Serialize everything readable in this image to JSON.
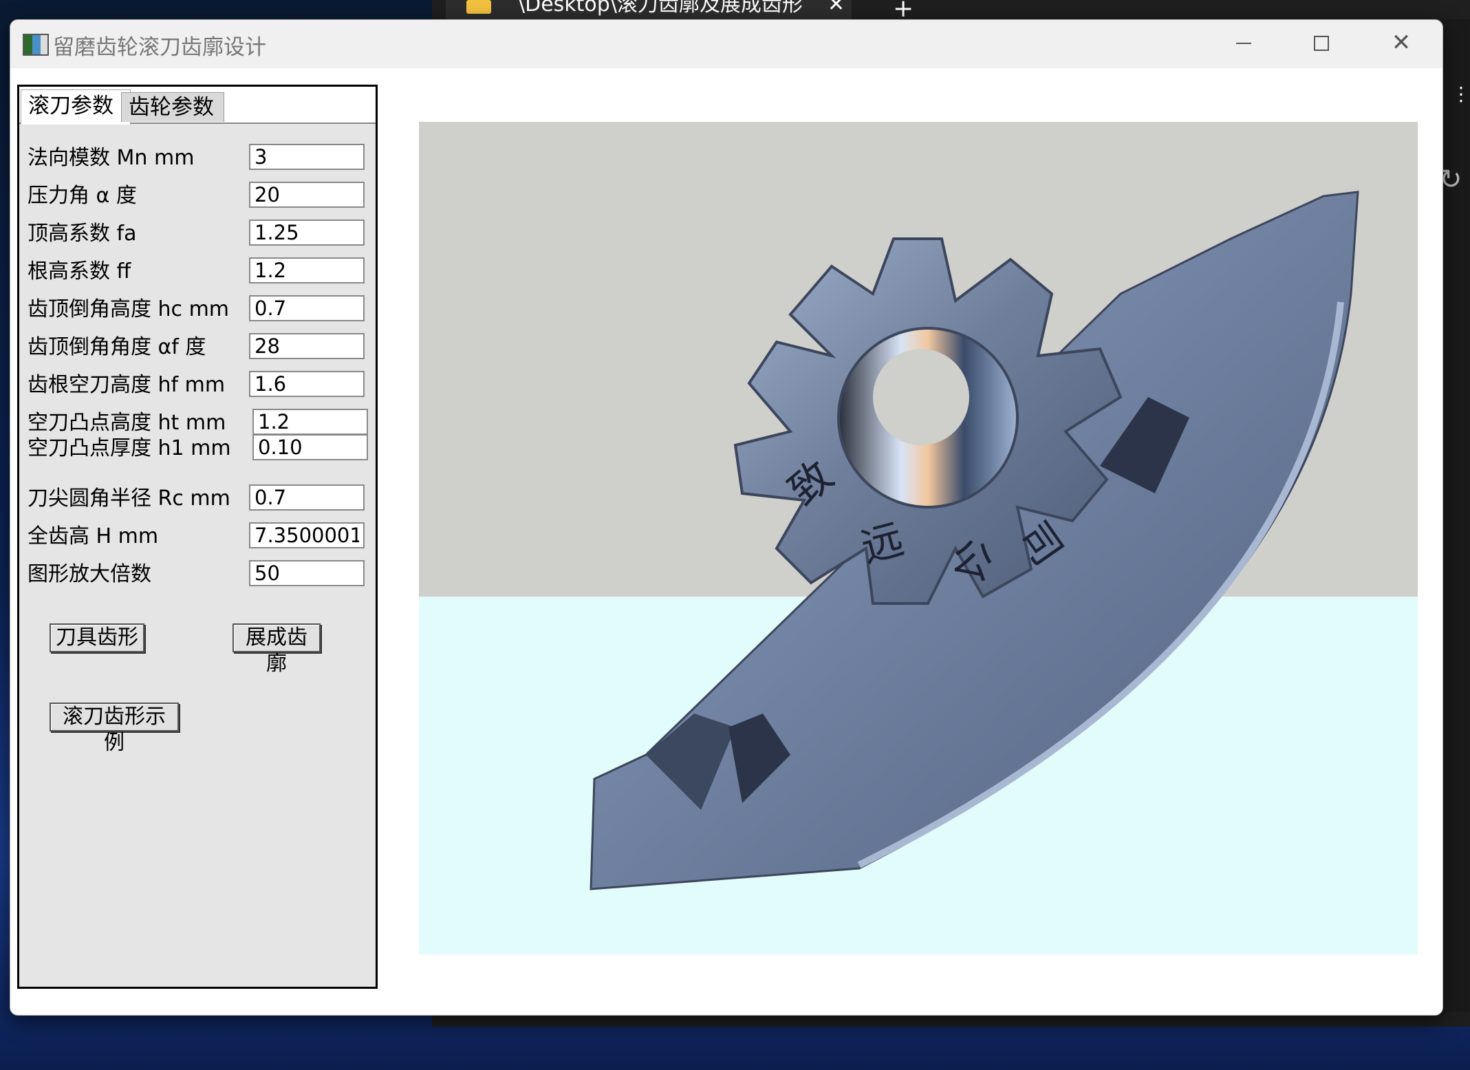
{
  "background_tab": {
    "title": "\\Desktop\\滚刀齿廓及展成齿形",
    "close_glyph": "✕",
    "new_tab_glyph": "+"
  },
  "window": {
    "title": "留磨齿轮滚刀齿廓设计",
    "controls": {
      "minimize": "minimize",
      "maximize": "maximize",
      "close": "✕"
    }
  },
  "tabs": [
    {
      "label": "滚刀参数",
      "active": true
    },
    {
      "label": "齿轮参数",
      "active": false
    }
  ],
  "fields": [
    {
      "label": "法向模数 Mn mm",
      "value": "3"
    },
    {
      "label": "压力角 α 度",
      "value": "20"
    },
    {
      "label": "顶高系数 fa",
      "value": "1.25"
    },
    {
      "label": "根高系数 ff",
      "value": "1.2"
    },
    {
      "label": "齿顶倒角高度 hc mm",
      "value": "0.7"
    },
    {
      "label": "齿顶倒角角度 αf 度",
      "value": "28"
    },
    {
      "label": "齿根空刀高度 hf mm",
      "value": "1.6"
    },
    {
      "label": "空刀凸点高度 ht mm",
      "value": "1.2"
    },
    {
      "label": "空刀凸点厚度 h1 mm",
      "value": "0.10"
    },
    {
      "label": "刀尖圆角半径 Rc mm",
      "value": "0.7"
    },
    {
      "label": "全齿高 H mm",
      "value": "7.35000014"
    },
    {
      "label": "图形放大倍数",
      "value": "50"
    }
  ],
  "buttons": {
    "tool_profile": "刀具齿形",
    "generated_profile": "展成齿廓",
    "hob_example": "滚刀齿形示例"
  },
  "preview": {
    "engraving": [
      "致",
      "远",
      "公",
      "司"
    ],
    "colors": {
      "wall": "#cfcfcc",
      "floor": "#e2fbfb",
      "gear": "#7a8aa6"
    }
  }
}
